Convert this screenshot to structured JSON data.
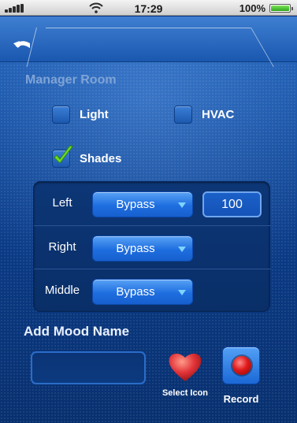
{
  "status_bar": {
    "time": "17:29",
    "battery_percent": "100%",
    "battery_level": 1.0
  },
  "header": {
    "back_icon": "undo-arrow-icon"
  },
  "room": {
    "title": "Manager Room",
    "options": [
      {
        "label": "Light",
        "checked": false
      },
      {
        "label": "HVAC",
        "checked": false
      },
      {
        "label": "Shades",
        "checked": true
      }
    ]
  },
  "shades": {
    "rows": [
      {
        "label": "Left",
        "mode": "Bypass",
        "value": "100"
      },
      {
        "label": "Right",
        "mode": "Bypass"
      },
      {
        "label": "Middle",
        "mode": "Bypass"
      }
    ]
  },
  "mood": {
    "title": "Add Mood Name",
    "name_value": "",
    "select_icon_label": "Select Icon",
    "record_label": "Record"
  },
  "colors": {
    "background": "#0a3a80",
    "accent": "#1e6ee0",
    "record_red": "#e01a1a"
  }
}
